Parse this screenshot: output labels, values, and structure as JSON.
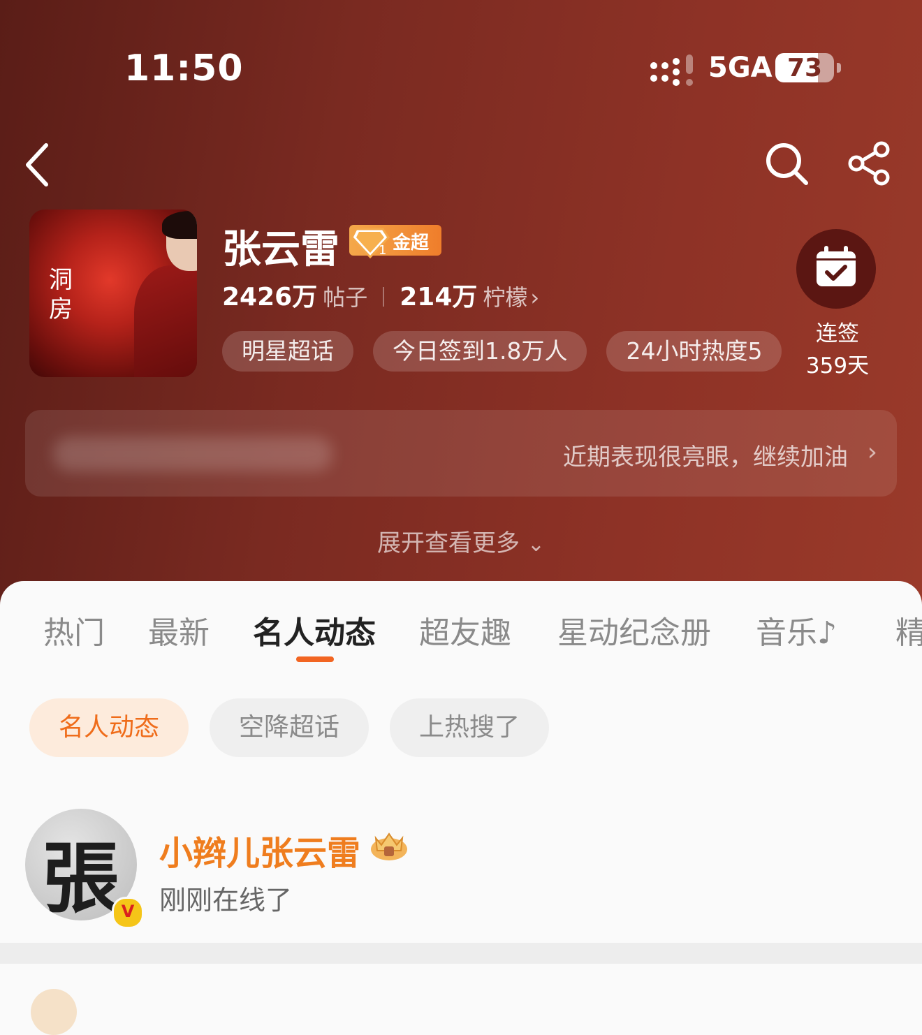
{
  "status_bar": {
    "time": "11:50",
    "network": "5GA",
    "battery": "73",
    "battery_level": 0.73
  },
  "icons": {
    "back": "back-chevron-icon",
    "search": "search-icon",
    "share": "share-icon",
    "checkin": "calendar-check-icon"
  },
  "topic": {
    "cover_title": "洞房",
    "name": "张云雷",
    "badge": "金超",
    "badge_level": "1",
    "posts_count": "2426万",
    "posts_label": "帖子",
    "fans_count": "214万",
    "fans_label": "柠檬",
    "tags": [
      "明星超话",
      "今日签到1.8万人",
      "24小时热度5"
    ]
  },
  "checkin": {
    "label": "连签",
    "days": "359天"
  },
  "banner": {
    "text": "近期表现很亮眼，继续加油"
  },
  "expand": {
    "label": "展开查看更多"
  },
  "tabs": [
    "热门",
    "最新",
    "名人动态",
    "超友趣",
    "星动纪念册",
    "音乐♪",
    "精"
  ],
  "active_tab": "名人动态",
  "filter_chips": [
    "名人动态",
    "空降超话",
    "上热搜了"
  ],
  "feed_item": {
    "avatar_char": "張",
    "verified_badge": "V",
    "name": "小辫儿张云雷",
    "status": "刚刚在线了"
  },
  "colors": {
    "accent": "#f26522",
    "hero": "#7a2a21",
    "username": "#ef7d1e",
    "badge": "#f4a84a"
  }
}
